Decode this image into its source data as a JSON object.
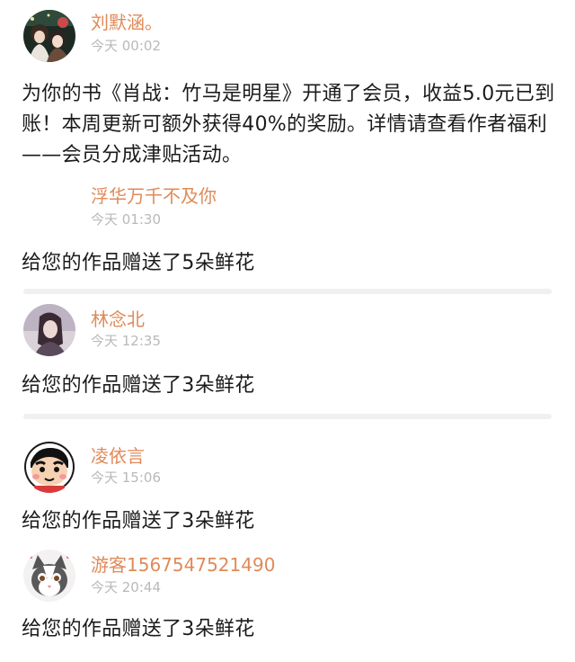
{
  "feed": {
    "entries": [
      {
        "username": "刘默涵。",
        "time": "今天 00:02",
        "message": "为你的书《肖战：竹马是明星》开通了会员，收益5.0元已到账！本周更新可额外获得40%的奖励。详情请查看作者福利——会员分成津贴活动。",
        "avatar_icon": "anime-couple-avatar-icon"
      },
      {
        "username": "浮华万千不及你",
        "time": "今天 01:30",
        "message": "给您的作品赠送了5朵鲜花",
        "avatar_icon": "blank-avatar"
      },
      {
        "username": "林念北",
        "time": "今天 12:35",
        "message": "给您的作品赠送了3朵鲜花",
        "avatar_icon": "girl-photo-avatar-icon"
      },
      {
        "username": "凌依言",
        "time": "今天 15:06",
        "message": "给您的作品赠送了3朵鲜花",
        "avatar_icon": "crayon-shinchan-avatar-icon"
      },
      {
        "username": "游客1567547521490",
        "time": "今天 20:44",
        "message": "给您的作品赠送了3朵鲜花",
        "avatar_icon": "cat-avatar-icon"
      }
    ]
  },
  "colors": {
    "username": "#e08a58",
    "timestamp": "#b9b9b9",
    "message": "#1b1b1b",
    "divider": "#f0f0ee"
  }
}
